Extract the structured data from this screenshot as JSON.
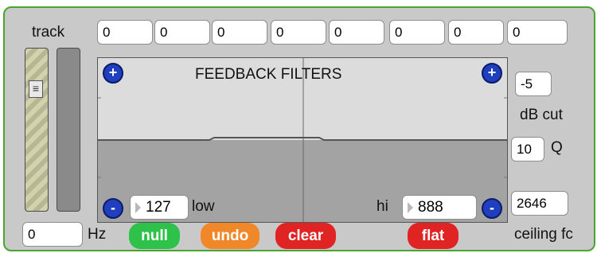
{
  "labels": {
    "track": "track",
    "title": "FEEDBACK FILTERS",
    "low": "low",
    "hi": "hi",
    "hz": "Hz",
    "db_cut": "dB cut",
    "q": "Q",
    "ceiling_fc": "ceiling fc"
  },
  "top_values": [
    "0",
    "0",
    "0",
    "0",
    "0",
    "0",
    "0",
    "0"
  ],
  "fields": {
    "db_cut": "-5",
    "q": "10",
    "ceiling": "2646",
    "hz": "0",
    "low": "127",
    "hi": "888"
  },
  "buttons": {
    "plus": "+",
    "minus": "-",
    "null": "null",
    "undo": "undo",
    "clear": "clear",
    "flat": "flat"
  },
  "icons": {
    "slider_thumb": "≡"
  },
  "colors": {
    "panel_border": "#4aa52e",
    "panel_bg": "#c9c9c9",
    "null": "#2fc24a",
    "undo": "#f0882a",
    "clear": "#e02323",
    "flat": "#e02323",
    "round_button": "#1f3fbf"
  }
}
